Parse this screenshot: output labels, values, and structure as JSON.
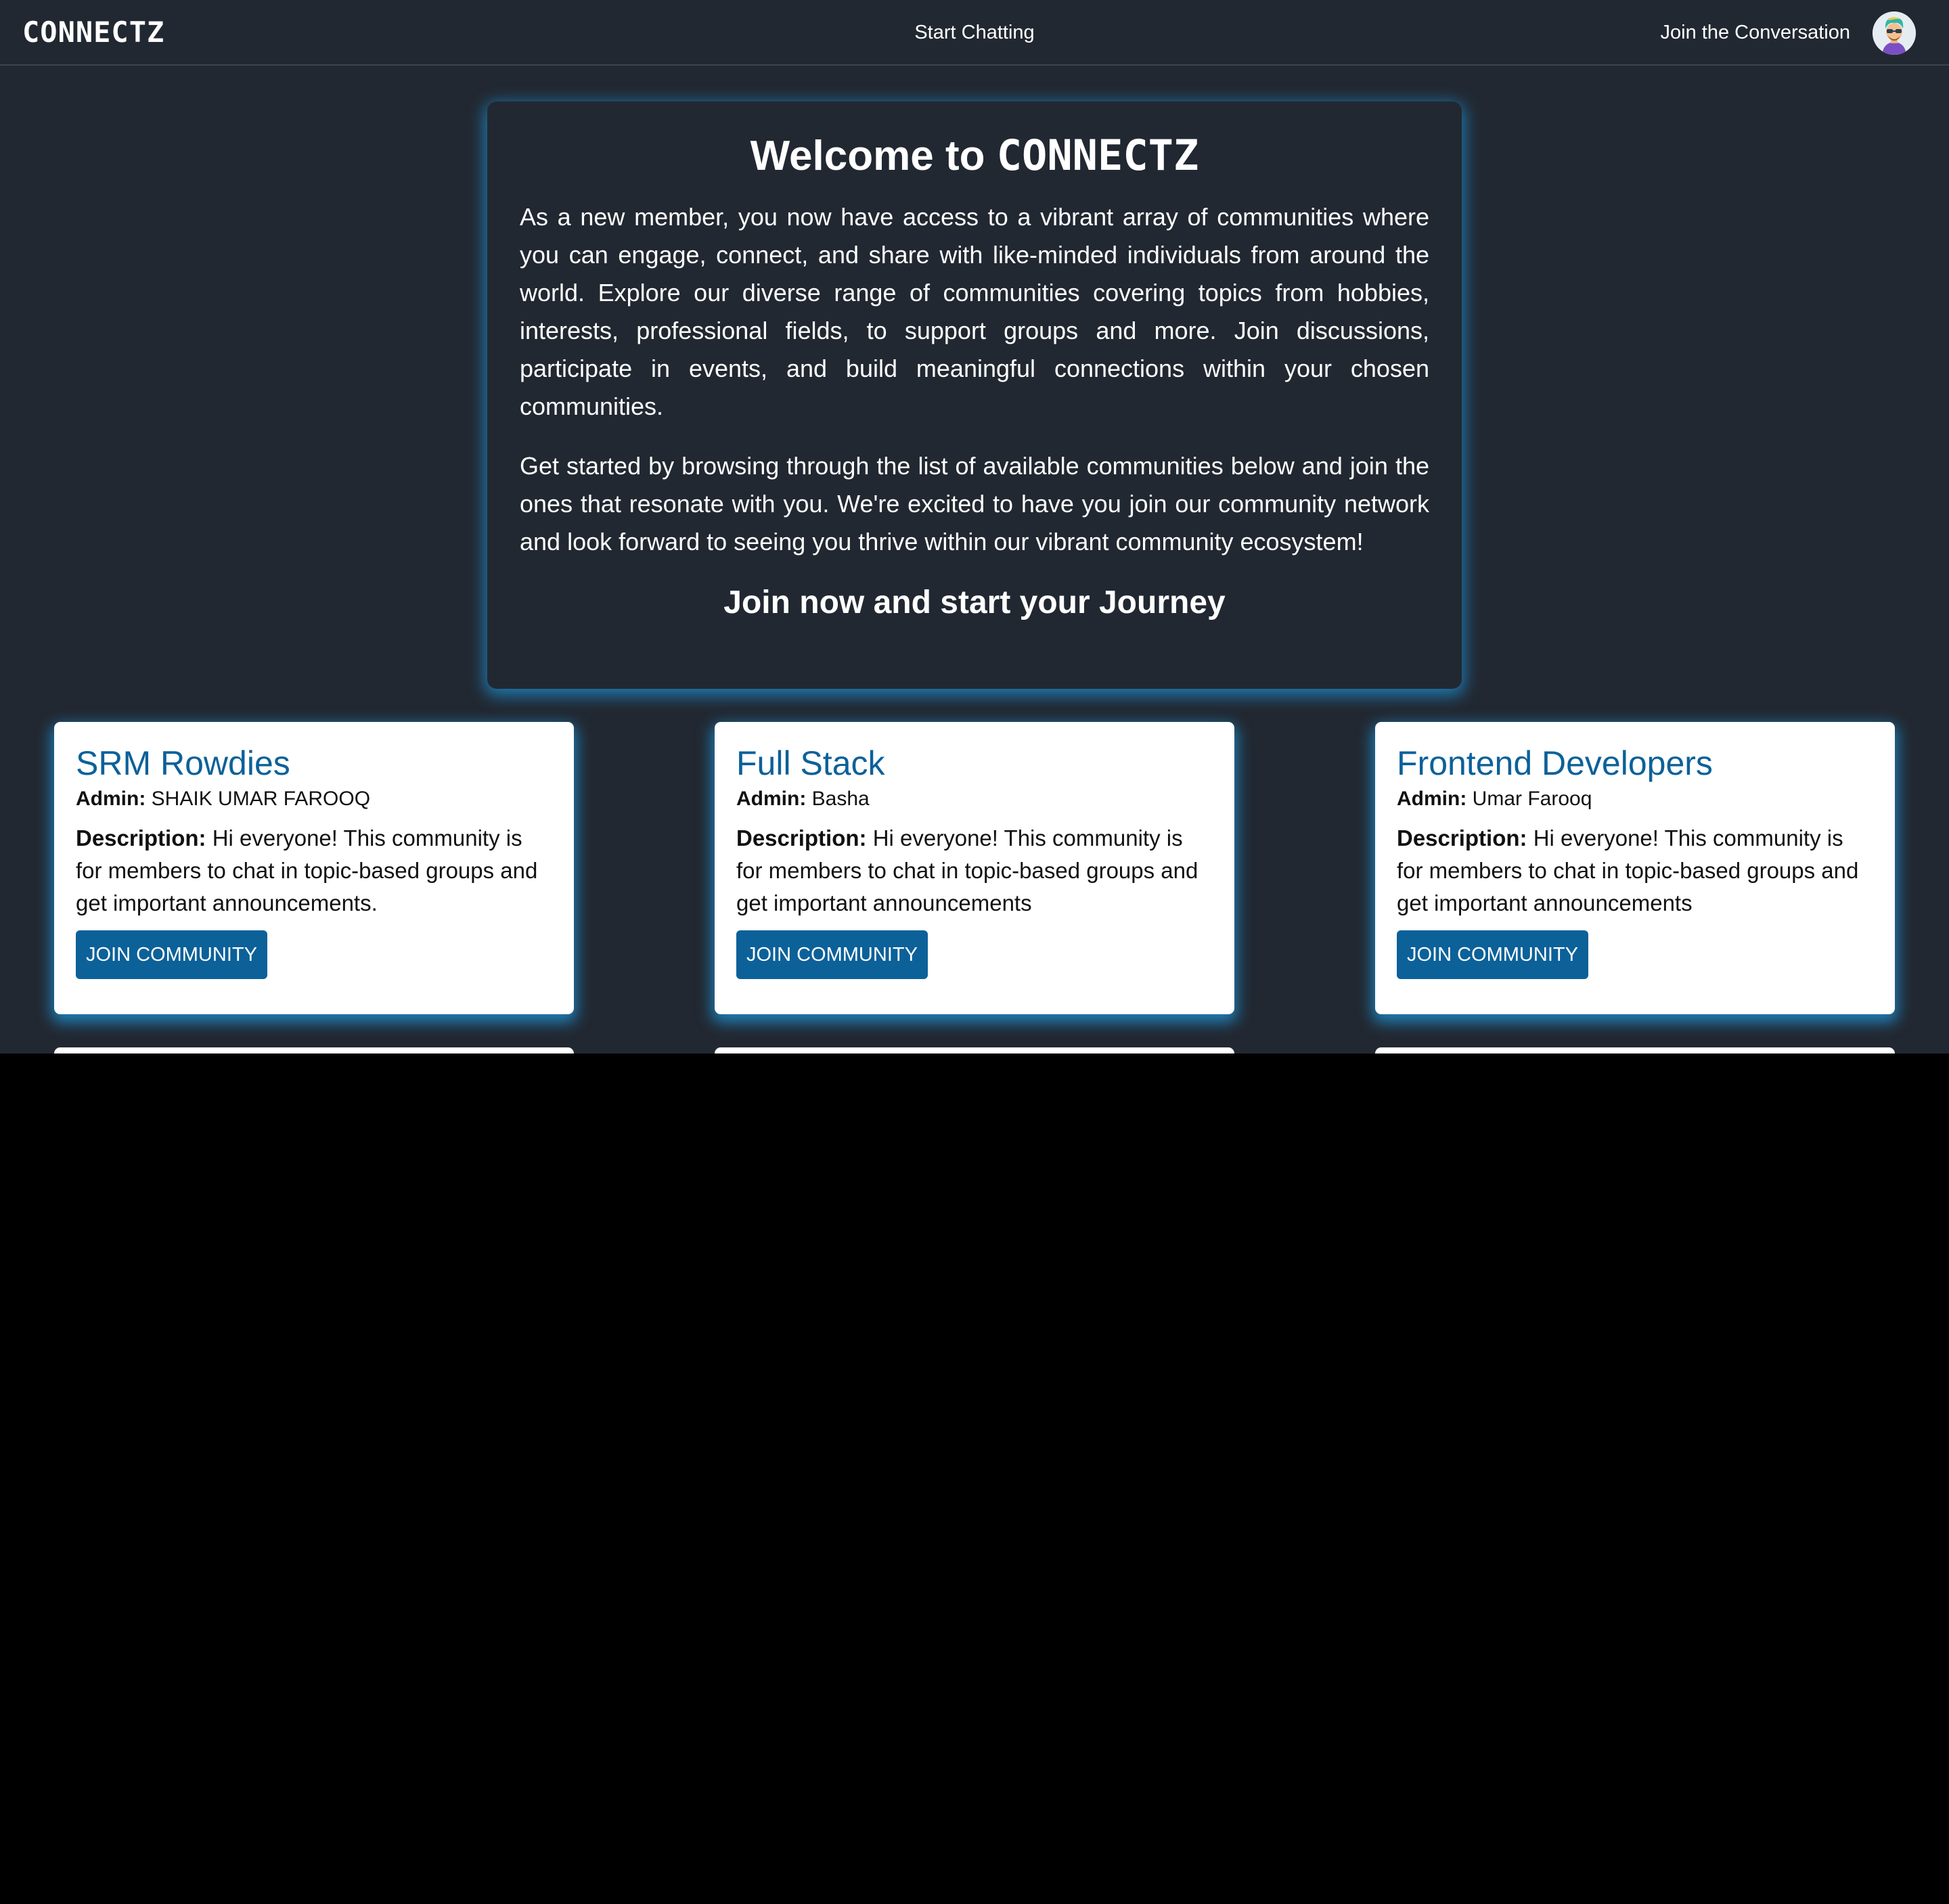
{
  "navbar": {
    "brand": "CONNECTZ",
    "center_link": "Start Chatting",
    "right_link": "Join the Conversation"
  },
  "welcome": {
    "title_prefix": "Welcome to ",
    "title_brand": "CONNECTZ",
    "paragraph1": "As a new member, you now have access to a vibrant array of communities where you can engage, connect, and share with like-minded individuals from around the world. Explore our diverse range of communities covering topics from hobbies, interests, professional fields, to support groups and more. Join discussions, participate in events, and build meaningful connections within your chosen communities.",
    "paragraph2": "Get started by browsing through the list of available communities below and join the ones that resonate with you. We're excited to have you join our community network and look forward to seeing you thrive within our vibrant community ecosystem!",
    "cta": "Join now and start your Journey"
  },
  "labels": {
    "admin": "Admin:",
    "description": "Description:"
  },
  "communities": [
    {
      "name": "SRM Rowdies",
      "admin": "SHAIK UMAR FAROOQ",
      "description": "Hi everyone! This community is for members to chat in topic-based groups and get important announcements.",
      "button": "JOIN COMMUNITY"
    },
    {
      "name": "Full Stack",
      "admin": "Basha",
      "description": "Hi everyone! This community is for members to chat in topic-based groups and get important announcements",
      "button": "JOIN COMMUNITY"
    },
    {
      "name": "Frontend Developers",
      "admin": "Umar Farooq",
      "description": "Hi everyone! This community is for members to chat in topic-based groups and get important announcements",
      "button": "JOIN COMMUNITY"
    }
  ],
  "colors": {
    "background": "#222831",
    "accent": "#0c6199",
    "glow": "#1e96dc",
    "card": "#ffffff"
  },
  "icons": {
    "avatar": "user-avatar-icon"
  }
}
